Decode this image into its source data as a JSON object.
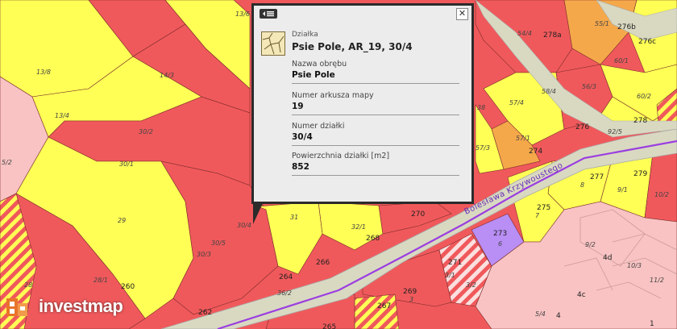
{
  "colors": {
    "red": "#f0595b",
    "yellow": "#ffff55",
    "orange": "#f5a84a",
    "pink": "#f9c3c3",
    "purple": "#b98ef5",
    "road": "#d9d9c2",
    "street_line": "#9b3ee0"
  },
  "map": {
    "plot_labels": [
      {
        "text": "13/6"
      },
      {
        "text": "14/3"
      },
      {
        "text": "13/8"
      },
      {
        "text": "13/4"
      },
      {
        "text": "30/2"
      },
      {
        "text": "30/1"
      },
      {
        "text": "29"
      },
      {
        "text": "28/1"
      },
      {
        "text": "28"
      },
      {
        "text": "30/4"
      },
      {
        "text": "30/5"
      },
      {
        "text": "30/3"
      },
      {
        "text": "31"
      },
      {
        "text": "32/1"
      },
      {
        "text": "54/4"
      },
      {
        "text": "55/1"
      },
      {
        "text": "57/4"
      },
      {
        "text": "57/1"
      },
      {
        "text": "58/4"
      },
      {
        "text": "57/3"
      },
      {
        "text": "56/3"
      },
      {
        "text": "60/1"
      },
      {
        "text": "60/2"
      },
      {
        "text": "92/5"
      },
      {
        "text": "9/1"
      },
      {
        "text": "8"
      },
      {
        "text": "7"
      },
      {
        "text": "6"
      },
      {
        "text": "10/2"
      },
      {
        "text": "9/2"
      },
      {
        "text": "10/3"
      },
      {
        "text": "11/2"
      },
      {
        "text": "5/4"
      },
      {
        "text": "3"
      },
      {
        "text": "3/1"
      },
      {
        "text": "3/2"
      },
      {
        "text": "36/2"
      },
      {
        "text": "38"
      },
      {
        "text": "5/2"
      }
    ],
    "address_labels": [
      {
        "text": "278a"
      },
      {
        "text": "276b"
      },
      {
        "text": "276c"
      },
      {
        "text": "276"
      },
      {
        "text": "278"
      },
      {
        "text": "274"
      },
      {
        "text": "277"
      },
      {
        "text": "279"
      },
      {
        "text": "275"
      },
      {
        "text": "273"
      },
      {
        "text": "271"
      },
      {
        "text": "270"
      },
      {
        "text": "268"
      },
      {
        "text": "266"
      },
      {
        "text": "264"
      },
      {
        "text": "269"
      },
      {
        "text": "267"
      },
      {
        "text": "265"
      },
      {
        "text": "262"
      },
      {
        "text": "260"
      },
      {
        "text": "4d"
      },
      {
        "text": "4c"
      },
      {
        "text": "4"
      },
      {
        "text": "1"
      }
    ],
    "street_name": "Bolesława Krzywoustego"
  },
  "popup": {
    "type_label": "Działka",
    "title": "Psie Pole, AR_19, 30/4",
    "fields": [
      {
        "label": "Nazwa obrębu",
        "value": "Psie Pole"
      },
      {
        "label": "Numer arkusza mapy",
        "value": "19"
      },
      {
        "label": "Numer działki",
        "value": "30/4"
      },
      {
        "label": "Powierzchnia działki [m2]",
        "value": "852"
      }
    ],
    "close_glyph": "✕"
  },
  "logo": {
    "text": "investmap"
  }
}
